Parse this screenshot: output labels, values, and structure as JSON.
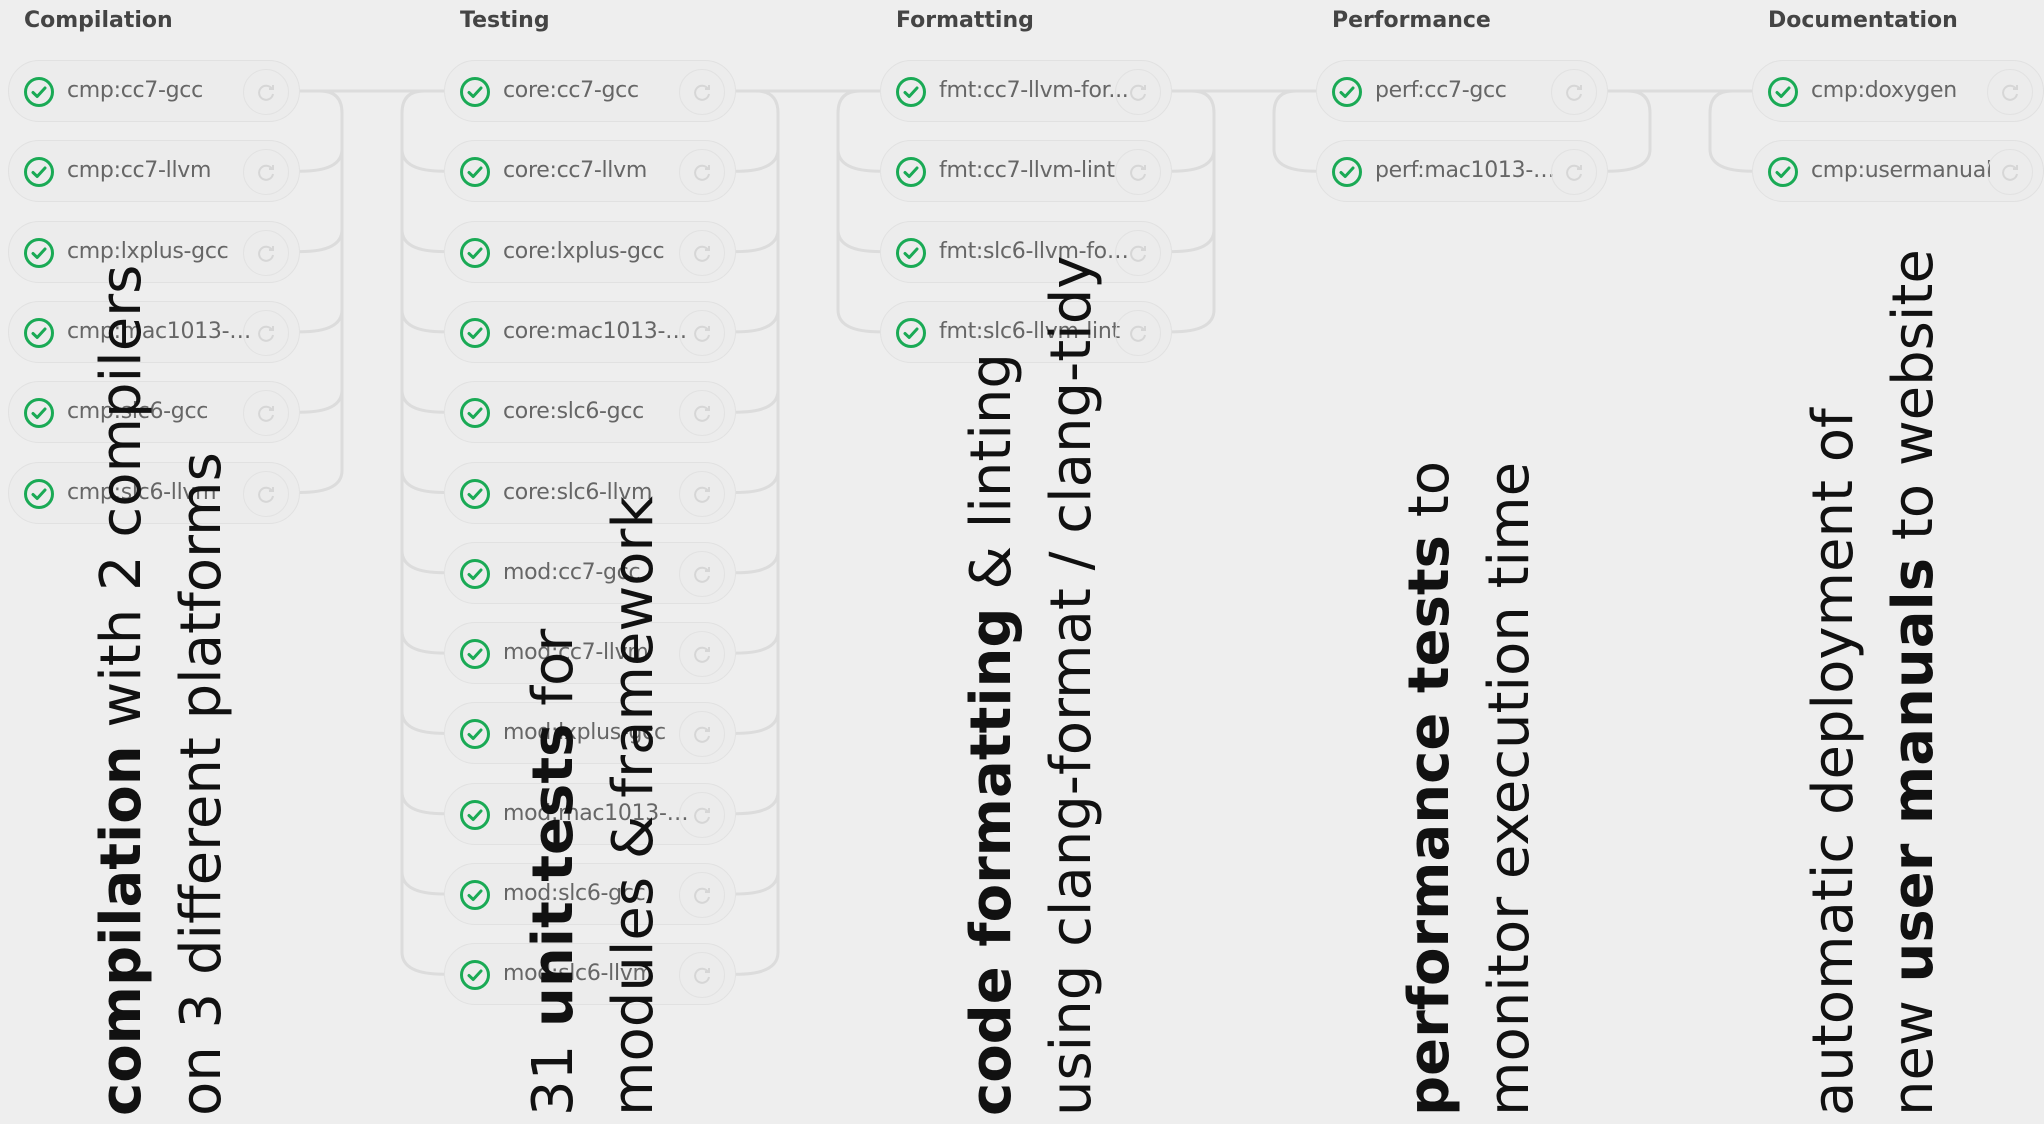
{
  "stages": [
    {
      "title": "Compilation",
      "jobs": [
        "cmp:cc7-gcc",
        "cmp:cc7-llvm",
        "cmp:lxplus-gcc",
        "cmp:mac1013-c...",
        "cmp:slc6-gcc",
        "cmp:slc6-llvm"
      ]
    },
    {
      "title": "Testing",
      "jobs": [
        "core:cc7-gcc",
        "core:cc7-llvm",
        "core:lxplus-gcc",
        "core:mac1013-c...",
        "core:slc6-gcc",
        "core:slc6-llvm",
        "mod:cc7-gcc",
        "mod:cc7-llvm",
        "mod:lxplus-gcc",
        "mod:mac1013-c...",
        "mod:slc6-gcc",
        "mod:slc6-llvm"
      ]
    },
    {
      "title": "Formatting",
      "jobs": [
        "fmt:cc7-llvm-for...",
        "fmt:cc7-llvm-lint",
        "fmt:slc6-llvm-for...",
        "fmt:slc6-llvm-lint"
      ]
    },
    {
      "title": "Performance",
      "jobs": [
        "perf:cc7-gcc",
        "perf:mac1013-cl..."
      ]
    },
    {
      "title": "Documentation",
      "jobs": [
        "cmp:doxygen",
        "cmp:usermanual"
      ]
    }
  ],
  "annotations": [
    {
      "line1": [
        [
          "compilation",
          true
        ],
        [
          " with 2 compilers",
          false
        ]
      ],
      "line2": [
        [
          "on 3 different platforms",
          false
        ]
      ]
    },
    {
      "line1": [
        [
          "31 ",
          false
        ],
        [
          "unit tests",
          true
        ],
        [
          " for",
          false
        ]
      ],
      "line2": [
        [
          "modules & framework",
          false
        ]
      ]
    },
    {
      "line1": [
        [
          "code formatting",
          true
        ],
        [
          " & linting",
          false
        ]
      ],
      "line2": [
        [
          "using clang-format / clang-tidy",
          false
        ]
      ]
    },
    {
      "line1": [
        [
          "performance tests",
          true
        ],
        [
          " to",
          false
        ]
      ],
      "line2": [
        [
          "monitor execution time",
          false
        ]
      ]
    },
    {
      "line1": [
        [
          "automatic deployment of",
          false
        ]
      ],
      "line2": [
        [
          "new ",
          false
        ],
        [
          "user manuals",
          true
        ],
        [
          " to website",
          false
        ]
      ]
    }
  ],
  "icons": {
    "status": "check-circle-icon",
    "retry": "retry-icon"
  },
  "colors": {
    "success": "#1aaa55",
    "background": "#eeeeee",
    "connector": "#dcdcdc"
  }
}
